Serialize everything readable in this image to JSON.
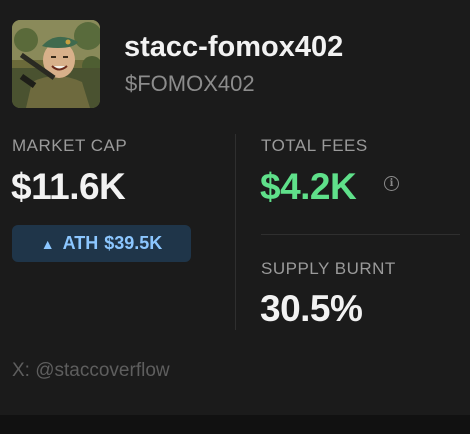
{
  "token": {
    "name": "stacc-fomox402",
    "ticker": "$FOMOX402",
    "avatar_icon": "soldier-portrait-avatar"
  },
  "stats": {
    "market_cap": {
      "label": "MARKET CAP",
      "value": "$11.6K"
    },
    "ath": {
      "icon": "triangle-up-icon",
      "label": "ATH",
      "value": "$39.5K"
    },
    "total_fees": {
      "label": "TOTAL FEES",
      "value": "$4.2K",
      "info_icon": "info-icon",
      "info_glyph": "i"
    },
    "supply_burnt": {
      "label": "SUPPLY BURNT",
      "value": "30.5%"
    }
  },
  "social": {
    "text": "X: @staccoverflow"
  },
  "colors": {
    "background": "#1b1b1b",
    "fees_green": "#5fe08a",
    "ath_bg": "#1f3549",
    "ath_text": "#8cc7ff",
    "muted": "#9a9a9a"
  }
}
